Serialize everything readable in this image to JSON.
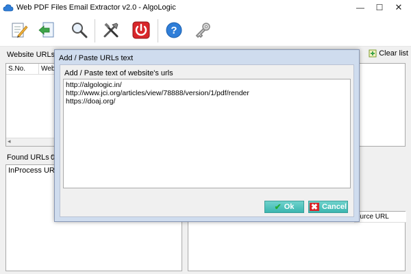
{
  "window": {
    "title": "Web PDF Files Email Extractor v2.0 - AlgoLogic",
    "minimize_glyph": "—",
    "maximize_glyph": "☐",
    "close_glyph": "✕"
  },
  "toolbar": {
    "icons": [
      "edit-icon",
      "import-icon",
      "search-icon",
      "tools-icon",
      "power-icon",
      "help-icon",
      "key-icon"
    ]
  },
  "main": {
    "website_urls_label": "Website URLs :",
    "website_table_headers": [
      "S.No.",
      "Web"
    ],
    "clear_list_label": "Clear list",
    "found_urls_label": "Found URLs :",
    "found_urls_value": "0",
    "inprocess_urls_label": "InProcess URLs",
    "source_url_header": "ource URL"
  },
  "dialog": {
    "title": "Add / Paste URLs text",
    "group_label": "Add / Paste text of website's urls",
    "lines": [
      "http://algologic.in/",
      "http://www.jci.org/articles/view/78888/version/1/pdf/render",
      "https://doaj.org/"
    ],
    "ok_label": "Ok",
    "cancel_label": "Cancel"
  },
  "colors": {
    "dialog_frame": "#cfdcee",
    "button_teal": "#3bb6b0",
    "ok_check": "#22aa33",
    "cancel_x": "#d8262a"
  }
}
